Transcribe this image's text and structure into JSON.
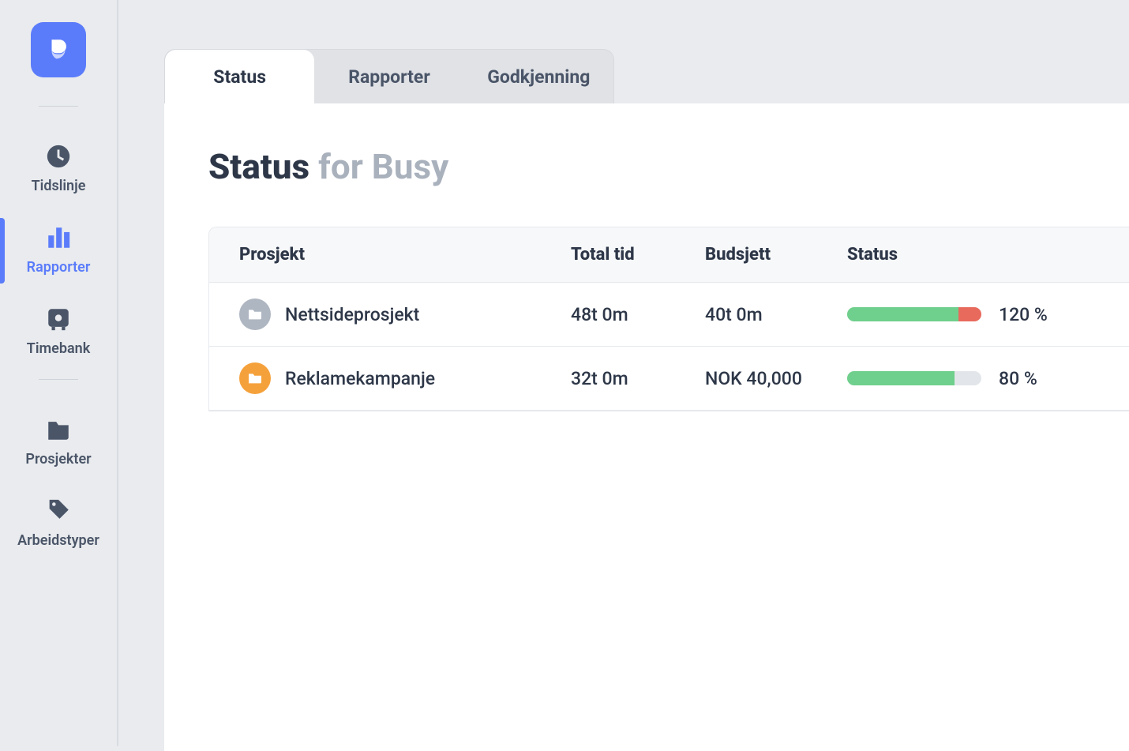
{
  "sidebar": {
    "items": [
      {
        "id": "tidslinje",
        "label": "Tidslinje",
        "icon": "clock"
      },
      {
        "id": "rapporter",
        "label": "Rapporter",
        "icon": "bars",
        "active": true
      },
      {
        "id": "timebank",
        "label": "Timebank",
        "icon": "safe"
      },
      {
        "id": "prosjekter",
        "label": "Prosjekter",
        "icon": "folder"
      },
      {
        "id": "arbeidstyper",
        "label": "Arbeidstyper",
        "icon": "tag"
      }
    ]
  },
  "tabs": [
    {
      "id": "status",
      "label": "Status",
      "active": true
    },
    {
      "id": "rapporter",
      "label": "Rapporter"
    },
    {
      "id": "godkjenning",
      "label": "Godkjenning"
    }
  ],
  "page": {
    "title_main": "Status",
    "title_sub": "for Busy"
  },
  "table": {
    "columns": {
      "project": "Prosjekt",
      "total": "Total tid",
      "budget": "Budsjett",
      "status": "Status"
    },
    "rows": [
      {
        "name": "Nettsideprosjekt",
        "badge_color": "#aeb6c1",
        "total": "48t 0m",
        "budget": "40t 0m",
        "percent_label": "120 %",
        "bar_green_pct": 83,
        "bar_red_pct": 17,
        "bar_bg_visible": false
      },
      {
        "name": "Reklamekampanje",
        "badge_color": "#f5a13b",
        "total": "32t 0m",
        "budget": "NOK 40,000",
        "percent_label": "80 %",
        "bar_green_pct": 80,
        "bar_red_pct": 0,
        "bar_bg_visible": true
      }
    ]
  }
}
